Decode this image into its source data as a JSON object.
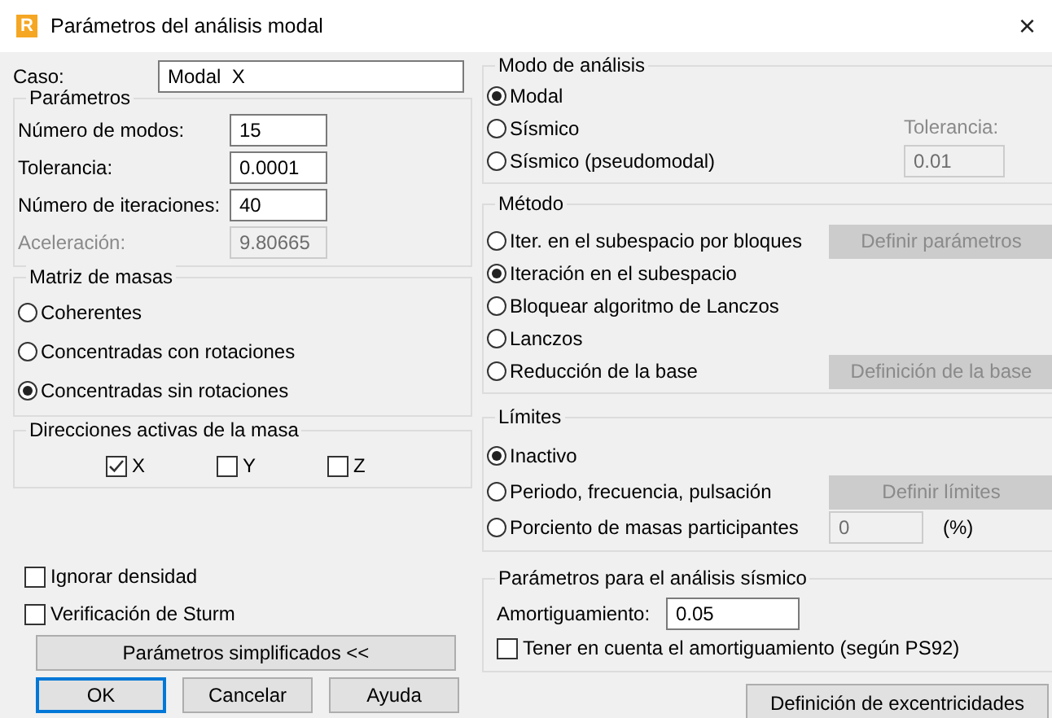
{
  "window": {
    "logo": "R",
    "title": "Parámetros del análisis modal",
    "close": "×"
  },
  "caso": {
    "label": "Caso:",
    "value": "Modal  X"
  },
  "parametros": {
    "title": "Parámetros",
    "fields": [
      {
        "label": "Número de modos:",
        "value": "15"
      },
      {
        "label": "Tolerancia:",
        "value": "0.0001"
      },
      {
        "label": "Número de iteraciones:",
        "value": "40"
      },
      {
        "label": "Aceleración:",
        "value": "9.80665",
        "disabled": true
      }
    ]
  },
  "matriz": {
    "title": "Matriz de masas",
    "options": [
      {
        "label": "Coherentes",
        "selected": false
      },
      {
        "label": "Concentradas con rotaciones",
        "selected": false
      },
      {
        "label": "Concentradas sin rotaciones",
        "selected": true
      }
    ]
  },
  "direcciones": {
    "title": "Direcciones activas de la masa",
    "options": [
      {
        "label": "X",
        "checked": true
      },
      {
        "label": "Y",
        "checked": false
      },
      {
        "label": "Z",
        "checked": false
      }
    ]
  },
  "options": [
    {
      "label": "Ignorar densidad",
      "checked": false
    },
    {
      "label": "Verificación de Sturm",
      "checked": false
    }
  ],
  "simplified_button": {
    "label": "Parámetros simplificados <<"
  },
  "buttons": [
    {
      "label": "OK",
      "default": true
    },
    {
      "label": "Cancelar",
      "default": false
    },
    {
      "label": "Ayuda",
      "default": false
    }
  ],
  "modo": {
    "title": "Modo de análisis",
    "options": [
      {
        "label": "Modal",
        "selected": true
      },
      {
        "label": "Sísmico",
        "selected": false
      },
      {
        "label": "Sísmico (pseudomodal)",
        "selected": false
      }
    ],
    "tolerance": {
      "label": "Tolerancia:",
      "value": "0.01",
      "disabled": true
    }
  },
  "metodo": {
    "title": "Método",
    "options": [
      {
        "label": "Iter. en el subespacio por bloques",
        "selected": false,
        "button": {
          "label": "Definir parámetros",
          "disabled": true
        }
      },
      {
        "label": "Iteración en el subespacio",
        "selected": true
      },
      {
        "label": "Bloquear algoritmo de Lanczos",
        "selected": false
      },
      {
        "label": "Lanczos",
        "selected": false
      },
      {
        "label": "Reducción de la base",
        "selected": false,
        "button": {
          "label": "Definición de la base",
          "disabled": true
        }
      }
    ]
  },
  "limites": {
    "title": "Límites",
    "options": [
      {
        "label": "Inactivo",
        "selected": true
      },
      {
        "label": "Periodo, frecuencia, pulsación",
        "selected": false,
        "button": {
          "label": "Definir límites",
          "disabled": true
        }
      },
      {
        "label": "Porciento de masas participantes",
        "selected": false,
        "field": {
          "value": "0",
          "unit": "(%)",
          "disabled": true
        }
      }
    ]
  },
  "sismico": {
    "title": "Parámetros para el análisis sísmico",
    "damping": {
      "label": "Amortiguamiento:",
      "value": "0.05"
    },
    "option": {
      "label": "Tener en cuenta el amortiguamiento (según PS92)",
      "checked": false
    }
  },
  "eccentricity_button": {
    "label": "Definición de excentricidades"
  }
}
